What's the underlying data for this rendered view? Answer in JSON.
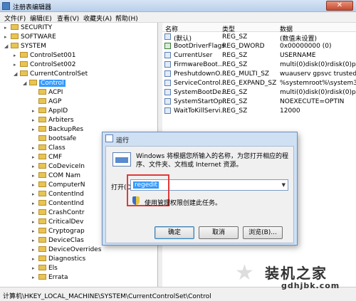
{
  "window": {
    "title": "注册表编辑器",
    "close_glyph": "✕"
  },
  "menu": [
    "文件(F)",
    "编辑(E)",
    "查看(V)",
    "收藏夹(A)",
    "帮助(H)"
  ],
  "tree": [
    {
      "label": "SECURITY",
      "depth": 2,
      "expand": "▸"
    },
    {
      "label": "SOFTWARE",
      "depth": 2,
      "expand": "▸"
    },
    {
      "label": "SYSTEM",
      "depth": 2,
      "expand": "◢"
    },
    {
      "label": "ControlSet001",
      "depth": 3,
      "expand": "▸"
    },
    {
      "label": "ControlSet002",
      "depth": 3,
      "expand": "▸"
    },
    {
      "label": "CurrentControlSet",
      "depth": 3,
      "expand": "◢"
    },
    {
      "label": "Control",
      "depth": 4,
      "expand": "◢",
      "selected": true
    },
    {
      "label": "ACPI",
      "depth": 5,
      "expand": ""
    },
    {
      "label": "AGP",
      "depth": 5,
      "expand": ""
    },
    {
      "label": "AppID",
      "depth": 5,
      "expand": "▸"
    },
    {
      "label": "Arbiters",
      "depth": 5,
      "expand": "▸"
    },
    {
      "label": "BackupRes",
      "depth": 5,
      "expand": "▸"
    },
    {
      "label": "bootsafe",
      "depth": 5,
      "expand": ""
    },
    {
      "label": "Class",
      "depth": 5,
      "expand": "▸"
    },
    {
      "label": "CMF",
      "depth": 5,
      "expand": "▸"
    },
    {
      "label": "CoDeviceIn",
      "depth": 5,
      "expand": "▸"
    },
    {
      "label": "COM Nam",
      "depth": 5,
      "expand": "▸"
    },
    {
      "label": "ComputerN",
      "depth": 5,
      "expand": "▸"
    },
    {
      "label": "ContentInd",
      "depth": 5,
      "expand": "▸"
    },
    {
      "label": "ContentInd",
      "depth": 5,
      "expand": "▸"
    },
    {
      "label": "CrashContr",
      "depth": 5,
      "expand": "▸"
    },
    {
      "label": "CriticalDev",
      "depth": 5,
      "expand": "▸"
    },
    {
      "label": "Cryptograp",
      "depth": 5,
      "expand": "▸"
    },
    {
      "label": "DeviceClas",
      "depth": 5,
      "expand": "▸"
    },
    {
      "label": "DeviceOverrides",
      "depth": 5,
      "expand": "▸"
    },
    {
      "label": "Diagnostics",
      "depth": 5,
      "expand": "▸"
    },
    {
      "label": "Els",
      "depth": 5,
      "expand": "▸"
    },
    {
      "label": "Errata",
      "depth": 5,
      "expand": "▸"
    }
  ],
  "list": {
    "headers": [
      "名称",
      "类型",
      "数据"
    ],
    "rows": [
      {
        "name": "(默认)",
        "type": "REG_SZ",
        "data": "(数值未设置)",
        "icon": "string"
      },
      {
        "name": "BootDriverFlags",
        "type": "REG_DWORD",
        "data": "0x00000000 (0)",
        "icon": "binary"
      },
      {
        "name": "CurrentUser",
        "type": "REG_SZ",
        "data": "USERNAME",
        "icon": "string"
      },
      {
        "name": "FirmwareBoot...",
        "type": "REG_SZ",
        "data": "multi(0)disk(0)rdisk(0)parti",
        "icon": "string"
      },
      {
        "name": "PreshutdownO...",
        "type": "REG_MULTI_SZ",
        "data": "wuauserv gpsvc trustedins",
        "icon": "string"
      },
      {
        "name": "ServiceControl...",
        "type": "REG_EXPAND_SZ",
        "data": "%systemroot%\\system32\\",
        "icon": "string"
      },
      {
        "name": "SystemBootDe...",
        "type": "REG_SZ",
        "data": "multi(0)disk(0)rdisk(0)parti",
        "icon": "string"
      },
      {
        "name": "SystemStartOp...",
        "type": "REG_SZ",
        "data": " NOEXECUTE=OPTIN",
        "icon": "string"
      },
      {
        "name": "WaitToKillServi...",
        "type": "REG_SZ",
        "data": "12000",
        "icon": "string"
      }
    ]
  },
  "status": "计算机\\HKEY_LOCAL_MACHINE\\SYSTEM\\CurrentControlSet\\Control",
  "run_dialog": {
    "title": "运行",
    "description": "Windows 将根据您所输入的名称，为您打开相应的程序、文件夹、文档或 Internet 资源。",
    "open_label": "打开(O):",
    "open_value": "regedit",
    "admin_note": "使用管理权限创建此任务。",
    "ok": "确定",
    "cancel": "取消",
    "browse": "浏览(B)..."
  },
  "watermark": {
    "text": "装机之家",
    "url": "gdhjbk.com"
  }
}
